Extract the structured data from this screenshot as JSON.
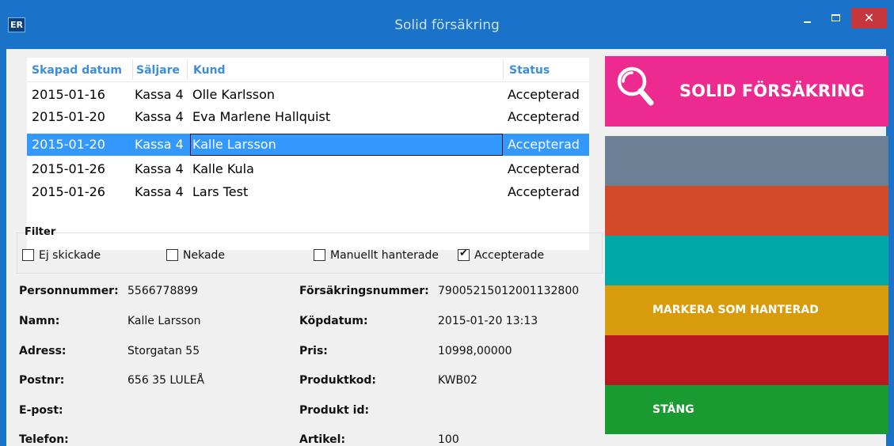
{
  "window": {
    "icon_label": "ER",
    "title": "Solid försäkring",
    "close_glyph": "✕"
  },
  "table": {
    "headers": [
      "Skapad datum",
      "Säljare",
      "Kund",
      "Status"
    ],
    "rows": [
      {
        "date": "2015-01-16",
        "seller": "Kassa 4",
        "customer": "Olle Karlsson",
        "status": "Accepterad"
      },
      {
        "date": "2015-01-20",
        "seller": "Kassa 4",
        "customer": "Eva Marlene Hallquist",
        "status": "Accepterad"
      },
      {
        "date": "2015-01-20",
        "seller": "Kassa 4",
        "customer": "Kalle Larsson",
        "status": "Accepterad",
        "selected": true
      },
      {
        "date": "2015-01-26",
        "seller": "Kassa 4",
        "customer": "Kalle Kula",
        "status": "Accepterad"
      },
      {
        "date": "2015-01-26",
        "seller": "Kassa 4",
        "customer": "Lars Test",
        "status": "Accepterad"
      }
    ]
  },
  "filter": {
    "title": "Filter",
    "options": [
      {
        "label": "Ej skickade",
        "checked": false
      },
      {
        "label": "Nekade",
        "checked": false
      },
      {
        "label": "Manuellt hanterade",
        "checked": false
      },
      {
        "label": "Accepterade",
        "checked": true
      }
    ]
  },
  "details": {
    "left": [
      {
        "label": "Personnummer:",
        "value": "5566778899"
      },
      {
        "label": "Namn:",
        "value": "Kalle Larsson"
      },
      {
        "label": "Adress:",
        "value": "Storgatan 55"
      },
      {
        "label": "Postnr:",
        "value": "656 35 LULEÅ"
      },
      {
        "label": "E-post:",
        "value": ""
      },
      {
        "label": "Telefon:",
        "value": ""
      }
    ],
    "right": [
      {
        "label": "Försäkringsnummer:",
        "value": "79005215012001132800"
      },
      {
        "label": "Köpdatum:",
        "value": "2015-01-20 13:13"
      },
      {
        "label": "Pris:",
        "value": "10998,00000"
      },
      {
        "label": "Produktkod:",
        "value": "KWB02"
      },
      {
        "label": "Produkt id:",
        "value": ""
      },
      {
        "label": "Artikel:",
        "value": "100"
      }
    ]
  },
  "tiles": {
    "brand": {
      "label": "SOLID FÖRSÄKRING",
      "color": "#ec2a8f",
      "icon": "search-icon"
    },
    "gray": {
      "label": "",
      "color": "#6d7f95"
    },
    "orange": {
      "label": "",
      "color": "#d24a27"
    },
    "teal": {
      "label": "",
      "color": "#00a9a8"
    },
    "mark": {
      "label": "MARKERA SOM HANTERAD",
      "color": "#d89b0c"
    },
    "red": {
      "label": "",
      "color": "#b8191e"
    },
    "close": {
      "label": "STÄNG",
      "color": "#1a9b31"
    }
  },
  "colors": {
    "titlebar": "#1a73c8",
    "header_text": "#3b8de0",
    "selection": "#3399ff"
  }
}
